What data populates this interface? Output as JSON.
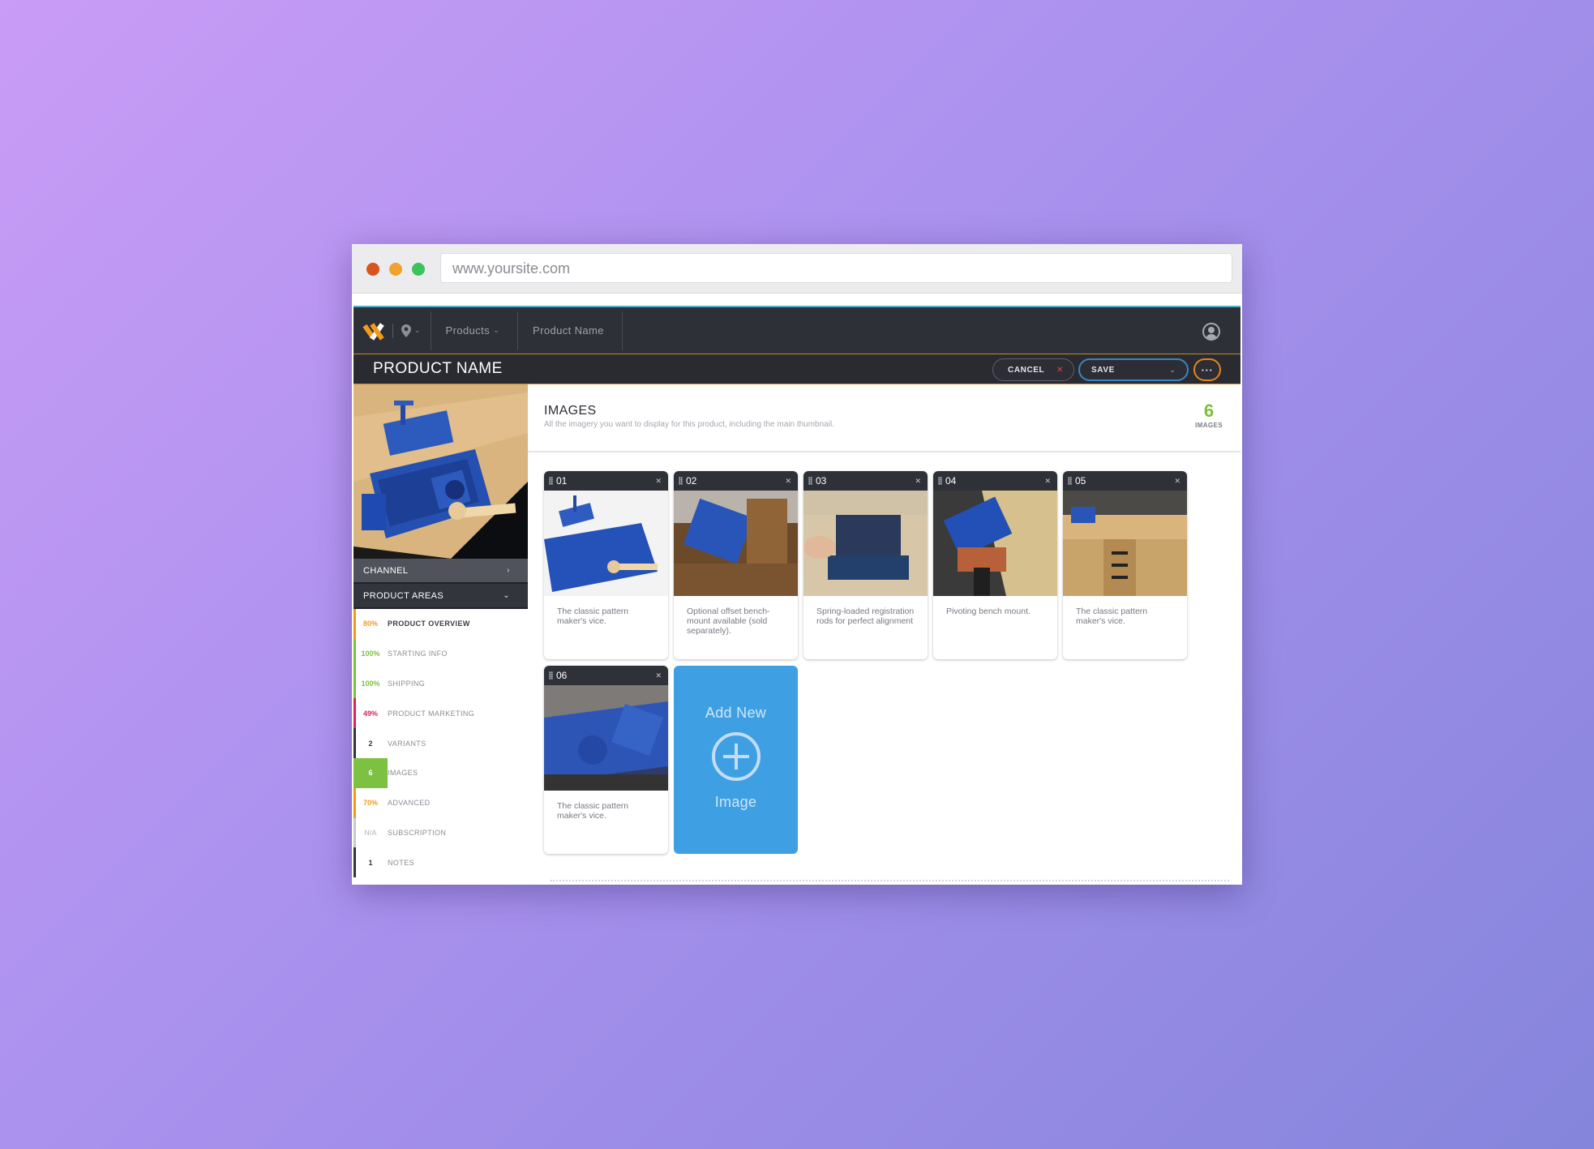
{
  "browser": {
    "url": "www.yoursite.com"
  },
  "topbar": {
    "crumbs": [
      "Products",
      "Product Name"
    ]
  },
  "titlebar": {
    "title": "PRODUCT NAME",
    "cancel_label": "CANCEL",
    "save_label": "SAVE",
    "more_label": "···"
  },
  "sidebar": {
    "channel_label": "CHANNEL",
    "areas_label": "PRODUCT AREAS",
    "items": [
      {
        "value": "80%",
        "label": "PRODUCT OVERVIEW",
        "color": "#f29a1c"
      },
      {
        "value": "100%",
        "label": "STARTING INFO",
        "color": "#7cc142"
      },
      {
        "value": "100%",
        "label": "SHIPPING",
        "color": "#7cc142"
      },
      {
        "value": "49%",
        "label": "PRODUCT MARKETING",
        "color": "#d8265b"
      },
      {
        "value": "2",
        "label": "VARIANTS",
        "color": "#33353d"
      },
      {
        "value": "6",
        "label": "IMAGES",
        "color": "#7cc142"
      },
      {
        "value": "70%",
        "label": "ADVANCED",
        "color": "#f29a1c"
      },
      {
        "value": "N/A",
        "label": "SUBSCRIPTION",
        "color": "#c8c9ce"
      },
      {
        "value": "1",
        "label": "NOTES",
        "color": "#33353d"
      }
    ]
  },
  "images_section": {
    "title": "IMAGES",
    "subtitle": "All the imagery you want to display for this product, including the main thumbnail.",
    "count": "6",
    "count_label": "IMAGES"
  },
  "cards": [
    {
      "num": "01",
      "caption": "The classic pattern maker's vice."
    },
    {
      "num": "02",
      "caption": "Optional offset bench-mount available (sold separately)."
    },
    {
      "num": "03",
      "caption": "Spring-loaded registration rods for perfect alignment"
    },
    {
      "num": "04",
      "caption": "Pivoting bench mount."
    },
    {
      "num": "05",
      "caption": "The classic pattern maker's vice."
    },
    {
      "num": "06",
      "caption": "The classic pattern maker's vice."
    }
  ],
  "add_card": {
    "line1": "Add New",
    "line2": "Image"
  },
  "colors": {
    "accent_blue": "#3f9fe3",
    "accent_green": "#7cc142",
    "accent_orange": "#f29a1c"
  }
}
